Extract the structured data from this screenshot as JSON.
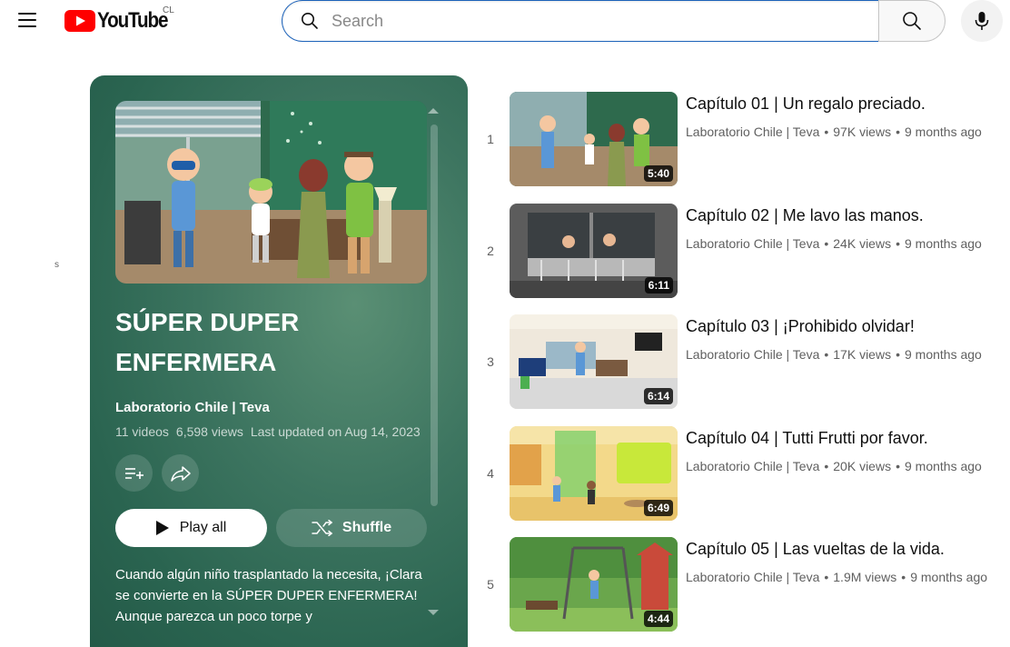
{
  "header": {
    "logo_text": "YouTube",
    "country_code": "CL",
    "search_placeholder": "Search",
    "icons": [
      "menu-icon",
      "youtube-logo-icon",
      "search-icon",
      "mic-icon"
    ]
  },
  "stray_text": "s",
  "playlist": {
    "title": "SÚPER DUPER ENFERMERA",
    "owner": "Laboratorio Chile | Teva",
    "video_count": "11 videos",
    "views": "6,598 views",
    "last_updated": "Last updated on Aug 14, 2023",
    "play_all_label": "Play all",
    "shuffle_label": "Shuffle",
    "description": "Cuando algún niño trasplantado la necesita, ¡Clara se convierte en la SÚPER DUPER ENFERMERA! Aunque parezca un poco torpe y",
    "accent_color": "#2f6b55"
  },
  "videos": [
    {
      "index": "1",
      "title": "Capítulo 01 | Un regalo preciado.",
      "channel": "Laboratorio Chile | Teva",
      "views": "97K views",
      "age": "9 months ago",
      "duration": "5:40"
    },
    {
      "index": "2",
      "title": "Capítulo 02 | Me lavo las manos.",
      "channel": "Laboratorio Chile | Teva",
      "views": "24K views",
      "age": "9 months ago",
      "duration": "6:11"
    },
    {
      "index": "3",
      "title": "Capítulo 03 | ¡Prohibido olvidar!",
      "channel": "Laboratorio Chile | Teva",
      "views": "17K views",
      "age": "9 months ago",
      "duration": "6:14"
    },
    {
      "index": "4",
      "title": "Capítulo 04 | Tutti Frutti por favor.",
      "channel": "Laboratorio Chile | Teva",
      "views": "20K views",
      "age": "9 months ago",
      "duration": "6:49"
    },
    {
      "index": "5",
      "title": "Capítulo 05 | Las vueltas de la vida.",
      "channel": "Laboratorio Chile | Teva",
      "views": "1.9M views",
      "age": "9 months ago",
      "duration": "4:44"
    }
  ],
  "colors": {
    "brand_red": "#ff0000",
    "search_focus": "#1c62b9"
  }
}
